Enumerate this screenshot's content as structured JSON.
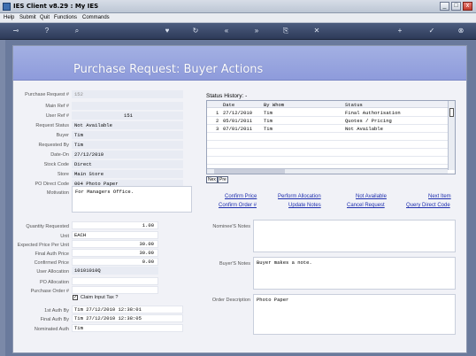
{
  "window": {
    "title": "IES Client v8.29 : My IES",
    "minimize": "_",
    "restore": "□",
    "close": "x"
  },
  "menu": [
    "Help",
    "Submit",
    "Quit",
    "Functions",
    "Commands"
  ],
  "page": {
    "heading": "Purchase Request: Buyer Actions"
  },
  "form": {
    "purchase_request_no": {
      "label": "Purchase Request #",
      "value": "152"
    },
    "main_ref": {
      "label": "Main Ref #",
      "value": ""
    },
    "user_ref": {
      "label": "User Ref #",
      "value": "151"
    },
    "request_status": {
      "label": "Request Status",
      "value": "Not Available"
    },
    "buyer": {
      "label": "Buyer",
      "value": "Tim"
    },
    "requested_by": {
      "label": "Requested By",
      "value": "Tim"
    },
    "date_on": {
      "label": "Date-On",
      "value": "27/12/2010"
    },
    "stock_code": {
      "label": "Stock Code",
      "value": "Direct"
    },
    "store": {
      "label": "Store",
      "value": "Main Store"
    },
    "po_direct_code": {
      "label": "PO Direct Code",
      "value": "004 Photo Paper"
    },
    "motivation": {
      "label": "Motivation",
      "value": "For Managers Office."
    },
    "quantity_requested": {
      "label": "Quantity Requested",
      "value": "1.00"
    },
    "unit": {
      "label": "Unit",
      "value": "EACH"
    },
    "expected_price": {
      "label": "Expected Price Per Unit",
      "value": "30.00"
    },
    "final_auth_price": {
      "label": "Final Auth Price",
      "value": "30.00"
    },
    "confirmed_price": {
      "label": "Confirmed Price",
      "value": "0.00"
    },
    "user_allocation": {
      "label": "User Allocation",
      "value": "10101010Q"
    },
    "po_allocation": {
      "label": "PO Allocation",
      "value": ""
    },
    "purchase_order": {
      "label": "Purchase Order #",
      "value": ""
    },
    "claim_input_tax": {
      "label": "Claim Input Tax ?",
      "checked": true
    },
    "first_auth_by": {
      "label": "1st Auth By",
      "value": "Tim 27/12/2010 12:38:01"
    },
    "final_auth_by": {
      "label": "Final Auth By",
      "value": "Tim 27/12/2010 12:38:05"
    },
    "nominated_auth": {
      "label": "Nominated Auth",
      "value": "Tim"
    }
  },
  "status_history": {
    "title": "Status History: -",
    "columns": [
      "Date",
      "By Whom",
      "Status"
    ],
    "rows": [
      {
        "n": "1",
        "date": "27/12/2010",
        "by": "Tim",
        "status": "Final Authorisation"
      },
      {
        "n": "2",
        "date": "05/01/2011",
        "by": "Tim",
        "status": "Quotes / Pricing"
      },
      {
        "n": "3",
        "date": "07/01/2011",
        "by": "Tim",
        "status": "Not Available"
      }
    ],
    "nav_next": "Nex",
    "nav_prev": "Pre"
  },
  "actions": {
    "confirm_price": "Confirm Price",
    "perform_allocation": "Perform Allocation",
    "not_available": "Not Available",
    "next_item": "Next Item",
    "confirm_order": "Confirm Order #",
    "update_notes": "Update Notes",
    "cancel_request": "Cancel Request",
    "query_direct_code": "Query Direct Code"
  },
  "notes": {
    "nominee_label": "Nominee'S Notes",
    "nominee_value": "",
    "buyer_label": "Buyer'S Notes",
    "buyer_value": "Buyer makes a note.",
    "order_desc_label": "Order Description",
    "order_desc_value": "Photo Paper"
  }
}
